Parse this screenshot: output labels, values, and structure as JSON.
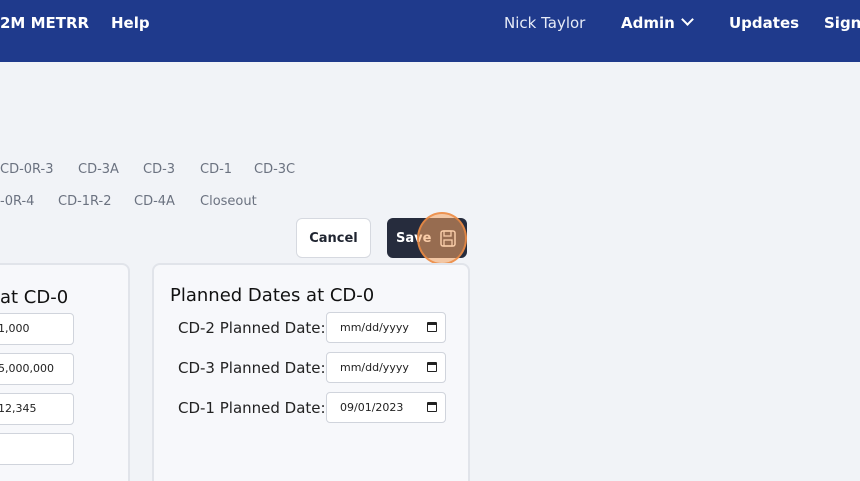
{
  "nav": {
    "app_name": "2M METRR",
    "help": "Help",
    "user": "Nick Taylor",
    "admin": "Admin",
    "updates": "Updates",
    "sign": "Sign"
  },
  "phase_tabs": {
    "row1": [
      "CD-0R-3",
      "CD-3A",
      "CD-3",
      "CD-1",
      "CD-3C"
    ],
    "row2": [
      "-0R-4",
      "CD-1R-2",
      "CD-4A",
      "Closeout"
    ]
  },
  "actions": {
    "cancel": "Cancel",
    "save": "Save"
  },
  "left_card": {
    "title": "at CD-0",
    "values": [
      "1,000",
      "5,000,000",
      "12,345",
      ""
    ]
  },
  "right_card": {
    "title": "Planned Dates at CD-0",
    "rows": [
      {
        "label": "CD-2 Planned Date:",
        "value": "mm/dd/yyyy"
      },
      {
        "label": "CD-3 Planned Date:",
        "value": "mm/dd/yyyy"
      },
      {
        "label": "CD-1 Planned Date:",
        "value": "09/01/2023"
      }
    ]
  },
  "colors": {
    "nav_bg": "#1f3a8c",
    "save_bg": "#262c3d",
    "click_highlight": "#f4a261"
  }
}
